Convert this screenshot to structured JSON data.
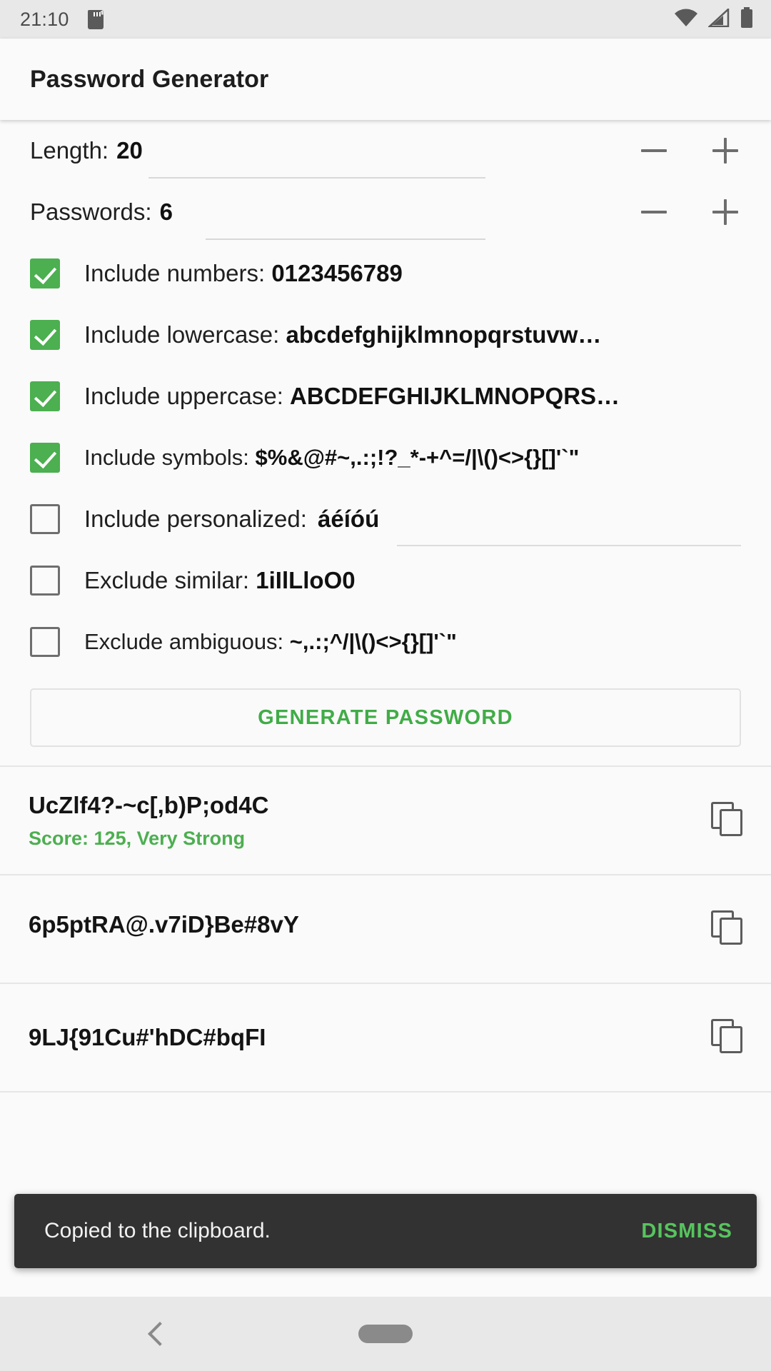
{
  "status_bar": {
    "clock": "21:10",
    "sdcard_icon": "sdcard-icon",
    "wifi_icon": "wifi-icon",
    "signal_icon": "cellular-signal-icon",
    "battery_icon": "battery-full-icon"
  },
  "app_bar": {
    "title": "Password Generator"
  },
  "settings": {
    "length": {
      "label": "Length:",
      "value": "20",
      "decrement_label": "–",
      "increment_label": "+"
    },
    "passwords": {
      "label": "Passwords:",
      "value": "6",
      "decrement_label": "–",
      "increment_label": "+"
    },
    "options": [
      {
        "label": "Include numbers:",
        "value": "0123456789",
        "checked": true,
        "name": "include-numbers"
      },
      {
        "label": "Include lowercase:",
        "value": "abcdefghijklmnopqrstuvw…",
        "checked": true,
        "name": "include-lowercase"
      },
      {
        "label": "Include uppercase:",
        "value": "ABCDEFGHIJKLMNOPQRS…",
        "checked": true,
        "name": "include-uppercase"
      },
      {
        "label": "Include symbols:",
        "value": "$%&@#~,.:;!?_*-+^=/|\\()<>{}[]'`\"",
        "checked": true,
        "name": "include-symbols"
      },
      {
        "label": "Include personalized:",
        "value": "áéíóú",
        "checked": false,
        "name": "include-personalized"
      },
      {
        "label": "Exclude similar:",
        "value": "1iIlLloO0",
        "checked": false,
        "name": "exclude-similar"
      },
      {
        "label": "Exclude ambiguous:",
        "value": "~,.:;^/|\\()<>{}[]'`\"",
        "checked": false,
        "name": "exclude-ambiguous"
      }
    ],
    "generate_button": "GENERATE PASSWORD"
  },
  "results": [
    {
      "password": "UcZlf4?-~c[,b)P;od4C",
      "score": "Score: 125, Very Strong",
      "copy_icon": "copy-icon"
    },
    {
      "password": "6p5ptRA@.v7iD}Be#8vY",
      "score": "",
      "copy_icon": "copy-icon"
    },
    {
      "password": "9LJ{91Cu#'hDC#bqFI",
      "score": "",
      "copy_icon": "copy-icon"
    }
  ],
  "snackbar": {
    "message": "Copied to the clipboard.",
    "action": "DISMISS"
  },
  "nav_bar": {
    "back_icon": "back-chevron-icon",
    "home_icon": "home-pill-icon"
  },
  "colors": {
    "accent_green": "#4caf50",
    "button_green": "#41ac47",
    "snackbar_bg": "#323232",
    "snackbar_action": "#57c45e"
  }
}
